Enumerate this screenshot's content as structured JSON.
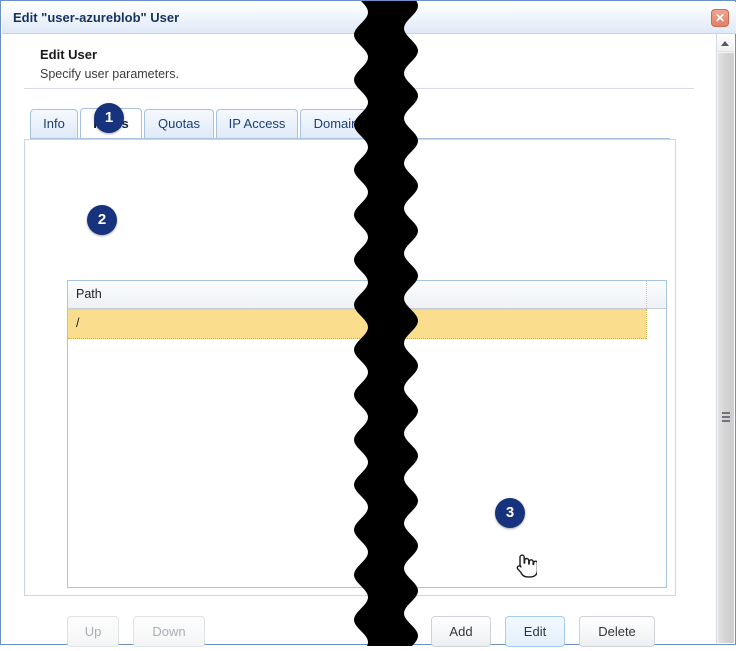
{
  "window": {
    "title": "Edit \"user-azureblob\" User",
    "close_icon": "close-icon",
    "close_glyph": "✕"
  },
  "header": {
    "title": "Edit User",
    "subtitle": "Specify user parameters."
  },
  "tabs": [
    {
      "label": "Info",
      "active": false
    },
    {
      "label": "Paths",
      "active": true
    },
    {
      "label": "Quotas",
      "active": false
    },
    {
      "label": "IP Access",
      "active": false
    },
    {
      "label": "Domain",
      "active": false
    }
  ],
  "grid": {
    "columns": [
      "Path"
    ],
    "rows": [
      {
        "path": "/",
        "selected": true
      }
    ]
  },
  "buttons": {
    "up": "Up",
    "down": "Down",
    "add": "Add",
    "edit": "Edit",
    "delete": "Delete"
  },
  "badges": [
    {
      "label": "1"
    },
    {
      "label": "2"
    },
    {
      "label": "3"
    }
  ],
  "scrollbar": {
    "up_arrow_icon": "caret-up-icon"
  },
  "colors": {
    "badge": "#17337e",
    "selected_row": "#fade8e",
    "title_text": "#16335f",
    "tab_border": "#a8c2e0",
    "close_button": "#e08166"
  }
}
